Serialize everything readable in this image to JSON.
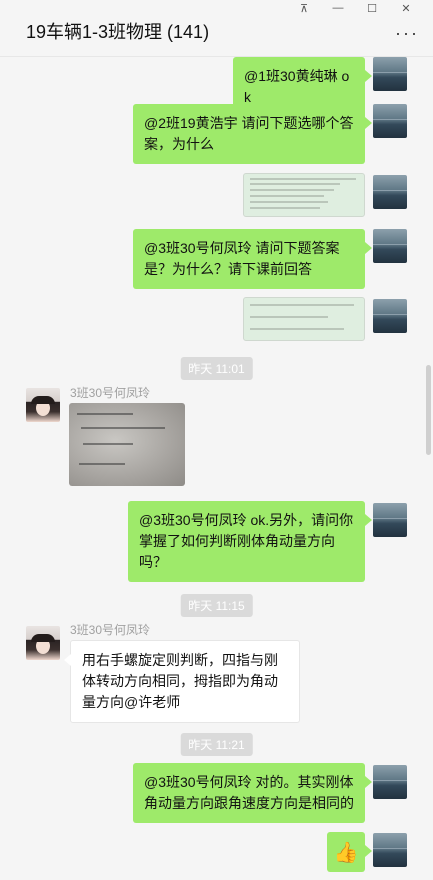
{
  "window": {
    "title": "19车辆1-3班物理 (141)",
    "pin_label": "⊼",
    "minimize_label": "—",
    "maximize_label": "☐",
    "close_label": "✕",
    "more_label": "···"
  },
  "messages": {
    "m1": "@1班30黄纯琳 ok",
    "m2": "@2班19黄浩宇 请问下题选哪个答案，为什么",
    "m3": "@3班30号何凤玲 请问下题答案是？为什么？请下课前回答",
    "m4": "@3班30号何凤玲 ok.另外，请问你掌握了如何判断刚体角动量方向吗？",
    "m5_sender": "3班30号何凤玲",
    "m5_photo": "image",
    "m6_sender": "3班30号何凤玲",
    "m6": "用右手螺旋定则判断，四指与刚体转动方向相同，拇指即为角动量方向@许老师",
    "m7": "@3班30号何凤玲 对的。其实刚体角动量方向跟角速度方向是相同的",
    "m8_emoji": "👍"
  },
  "timestamps": {
    "t1": "昨天 11:01",
    "t2": "昨天 11:15",
    "t3": "昨天 11:21"
  }
}
